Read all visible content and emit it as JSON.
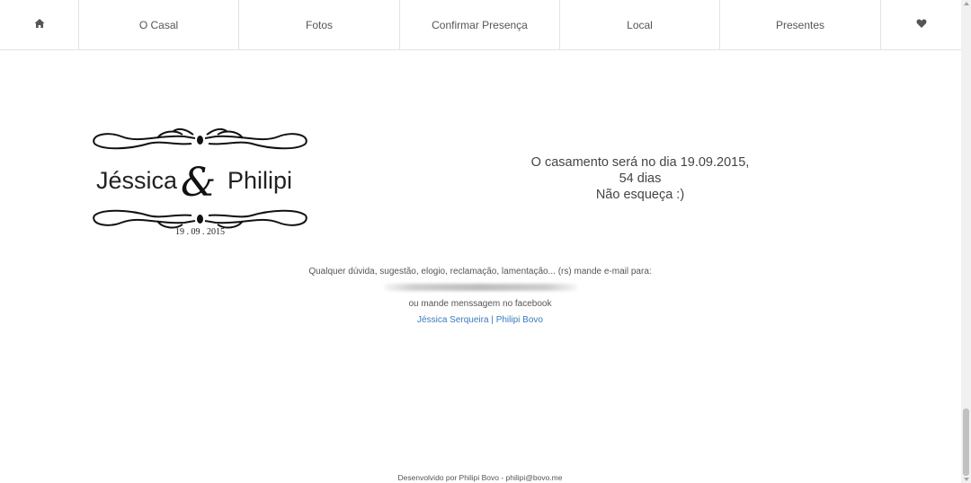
{
  "nav": {
    "home_icon": "home-icon",
    "items": [
      {
        "label": "O Casal"
      },
      {
        "label": "Fotos"
      },
      {
        "label": "Confirmar Presença"
      },
      {
        "label": "Local"
      },
      {
        "label": "Presentes"
      }
    ],
    "heart_icon": "heart-icon"
  },
  "logo": {
    "name_left": "Jéssica",
    "ampersand": "&",
    "name_right": "Philipi",
    "date": "19 . 09 . 2015"
  },
  "countdown": {
    "line1": "O casamento será no dia 19.09.2015,",
    "line2": "54 dias",
    "line3": "Não esqueça :)"
  },
  "contact": {
    "intro": "Qualquer dúvida, sugestão, elogio, reclamação, lamentação... (rs) mande e-mail para:",
    "facebook_text": "ou mande menssagem no facebook",
    "link1": "Jéssica Serqueira",
    "separator": "|",
    "link2": "Philipi Bovo"
  },
  "footer": {
    "text": "Desenvolvido por Philipi Bovo - philipi@bovo.me"
  },
  "colors": {
    "link": "#3a7bbd",
    "border": "#e3e3e3"
  }
}
